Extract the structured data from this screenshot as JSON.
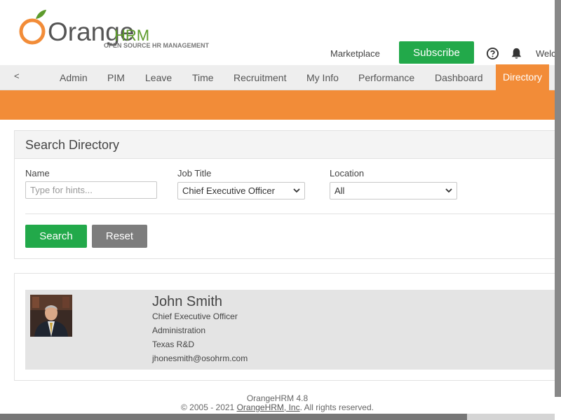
{
  "header": {
    "logo_word_orange": "Orange",
    "logo_word_hrm": "HRM",
    "logo_tagline": "OPEN SOURCE HR MANAGEMENT",
    "marketplace_label": "Marketplace",
    "subscribe_label": "Subscribe",
    "welcome_text": "Welc"
  },
  "nav": {
    "back_label": "<",
    "items": [
      "Admin",
      "PIM",
      "Leave",
      "Time",
      "Recruitment",
      "My Info",
      "Performance",
      "Dashboard",
      "Directory"
    ],
    "active": "Directory"
  },
  "search": {
    "title": "Search Directory",
    "name_label": "Name",
    "name_placeholder": "Type for hints...",
    "name_value": "",
    "job_title_label": "Job Title",
    "job_title_value": "Chief Executive Officer",
    "location_label": "Location",
    "location_value": "All",
    "search_button": "Search",
    "reset_button": "Reset"
  },
  "results": [
    {
      "name": "John Smith",
      "job_title": "Chief Executive Officer",
      "department": "Administration",
      "location": "Texas R&D",
      "email": "jhonesmith@osohrm.com"
    }
  ],
  "footer": {
    "version": "OrangeHRM 4.8",
    "copyright_prefix": "© 2005 - 2021 ",
    "company_link": "OrangeHRM, Inc",
    "copyright_suffix": ". All rights reserved."
  },
  "colors": {
    "brand_orange": "#f28c38",
    "button_green": "#22a94a",
    "button_gray": "#7d7d7d",
    "logo_green": "#5d9b2c"
  },
  "icons": {
    "help": "help-circle-icon",
    "notifications": "bell-icon",
    "photo": "employee-photo"
  }
}
